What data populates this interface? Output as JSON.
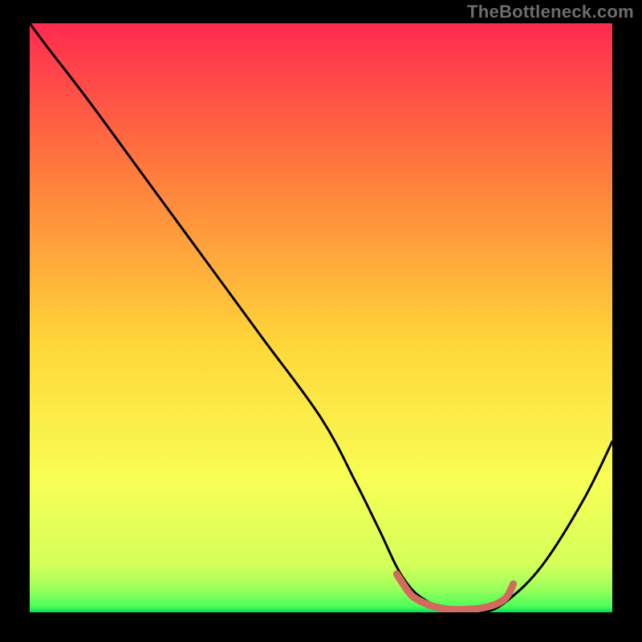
{
  "watermark": "TheBottleneck.com",
  "chart_data": {
    "type": "line",
    "title": "",
    "xlabel": "",
    "ylabel": "",
    "xlim": [
      0,
      100
    ],
    "ylim": [
      0,
      100
    ],
    "gradient_colors": {
      "top": "#ff2a4f",
      "upper_mid": "#ff7a3d",
      "mid": "#ffd83a",
      "lower_mid": "#f7ff55",
      "near_bottom": "#9cff5a",
      "bottom": "#00e05a"
    },
    "series": [
      {
        "name": "curve",
        "color": "#000000",
        "x": [
          0,
          3,
          10,
          20,
          30,
          40,
          50,
          56,
          60,
          64,
          68,
          74,
          78,
          82,
          88,
          95,
          100
        ],
        "y": [
          100,
          96,
          87,
          73.5,
          60,
          46.5,
          33,
          22,
          14,
          6,
          2,
          0,
          0,
          2,
          8,
          19,
          29
        ]
      }
    ],
    "highlight_segment": {
      "name": "flat-min-band",
      "color": "#d26a60",
      "points_x": [
        63,
        65,
        66.5,
        69,
        72,
        75,
        78,
        80.5,
        82,
        83
      ],
      "points_y": [
        6.5,
        3.5,
        2.2,
        1.1,
        0.5,
        0.5,
        0.8,
        1.6,
        2.8,
        4.8
      ]
    }
  }
}
